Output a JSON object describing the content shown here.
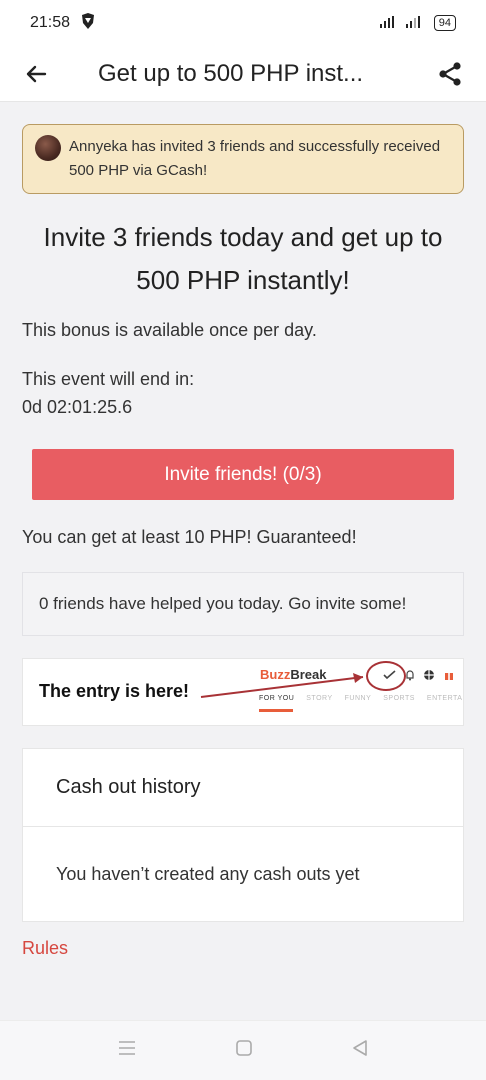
{
  "status": {
    "time": "21:58",
    "battery": "94"
  },
  "appbar": {
    "title": "Get up to 500 PHP inst..."
  },
  "banner": {
    "text": "Annyeka has invited 3 friends and successfully received 500 PHP via GCash!"
  },
  "headline": "Invite 3 friends today and get up to 500 PHP instantly!",
  "bonus_text": "This bonus is available once per day.",
  "event_end_label": "This event will end in:",
  "countdown": "0d 02:01:25.6",
  "invite_button": "Invite friends! (0/3)",
  "guarantee_text": "You can get at least 10 PHP! Guaranteed!",
  "helped_text": "0 friends have helped you today. Go invite some!",
  "entry": {
    "text": "The entry is here!",
    "logo_part1": "Buzz",
    "logo_part2": "Break",
    "tabs": [
      "FOR YOU",
      "STORY",
      "FUNNY",
      "SPORTS",
      "ENTERTA"
    ]
  },
  "cashout": {
    "title": "Cash out history",
    "empty": "You haven’t created any cash outs yet"
  },
  "rules_link": "Rules",
  "colors": {
    "accent": "#e85d62",
    "banner_bg": "#f7e8c6",
    "rules": "#d6473f"
  }
}
